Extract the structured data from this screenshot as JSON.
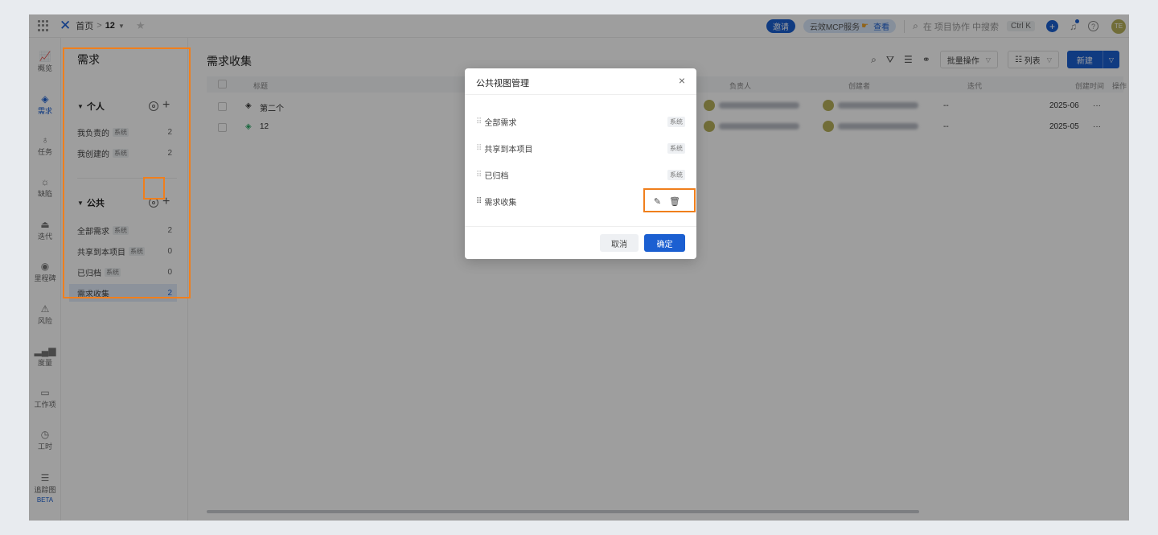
{
  "topbar": {
    "breadcrumb_home": "首页",
    "breadcrumb_sep": ">",
    "project": "12",
    "invite_label": "邀请",
    "mcp_label": "云效MCP服务",
    "mcp_view": "查看",
    "search_placeholder": "在 项目协作 中搜索",
    "shortcut": "Ctrl K",
    "avatar_text": "TE"
  },
  "leftnav": {
    "items": [
      {
        "label": "概览",
        "icon": "chart-line-icon"
      },
      {
        "label": "需求",
        "icon": "layers-icon"
      },
      {
        "label": "任务",
        "icon": "bulb-icon"
      },
      {
        "label": "缺陷",
        "icon": "bug-icon"
      },
      {
        "label": "迭代",
        "icon": "iteration-icon"
      },
      {
        "label": "里程碑",
        "icon": "pin-icon"
      },
      {
        "label": "风险",
        "icon": "warning-icon"
      },
      {
        "label": "度量",
        "icon": "bars-icon"
      },
      {
        "label": "工作项",
        "icon": "folder-icon"
      },
      {
        "label": "工时",
        "icon": "timer-icon"
      },
      {
        "label": "追踪图",
        "icon": "trace-icon"
      }
    ],
    "beta_label": "BETA"
  },
  "sidebar": {
    "title": "需求",
    "personal_label": "个人",
    "public_label": "公共",
    "system_tag": "系统",
    "personal_items": [
      {
        "label": "我负责的",
        "count": "2"
      },
      {
        "label": "我创建的",
        "count": "2"
      }
    ],
    "public_items": [
      {
        "label": "全部需求",
        "count": "2",
        "system": true
      },
      {
        "label": "共享到本项目",
        "count": "0",
        "system": true
      },
      {
        "label": "已归档",
        "count": "0",
        "system": true
      },
      {
        "label": "需求收集",
        "count": "2",
        "system": false
      }
    ]
  },
  "main": {
    "title": "需求收集",
    "batch_label": "批量操作",
    "view_label": "列表",
    "new_label": "新建",
    "columns": {
      "title": "标题",
      "owner": "负责人",
      "creator": "创建者",
      "iteration": "迭代",
      "created": "创建时间",
      "ops": "操作"
    },
    "rows": [
      {
        "title": "第二个",
        "iteration": "--",
        "created": "2025-06",
        "more": "···"
      },
      {
        "title": "12",
        "iteration": "--",
        "created": "2025-05",
        "more": "···"
      }
    ]
  },
  "modal": {
    "title": "公共视图管理",
    "close": "×",
    "system_tag": "系统",
    "views": [
      {
        "label": "全部需求",
        "system": true
      },
      {
        "label": "共享到本项目",
        "system": true
      },
      {
        "label": "已归档",
        "system": true
      },
      {
        "label": "需求收集",
        "system": false
      }
    ],
    "cancel_label": "取消",
    "ok_label": "确定"
  },
  "colors": {
    "accent": "#1b5fd1",
    "highlight": "#f07f1c"
  }
}
